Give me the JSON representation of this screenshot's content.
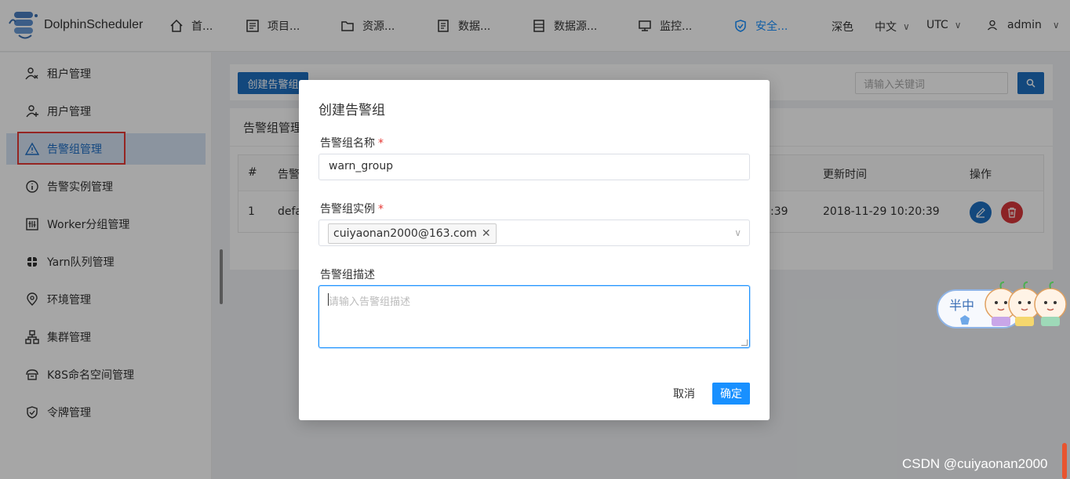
{
  "app": {
    "name": "DolphinScheduler"
  },
  "nav": {
    "items": [
      {
        "label": "首...",
        "icon": "home-icon"
      },
      {
        "label": "项目...",
        "icon": "project-icon"
      },
      {
        "label": "资源...",
        "icon": "folder-icon"
      },
      {
        "label": "数据...",
        "icon": "file-icon"
      },
      {
        "label": "数据源...",
        "icon": "datasource-icon"
      },
      {
        "label": "监控...",
        "icon": "monitor-icon"
      },
      {
        "label": "安全...",
        "icon": "security-icon"
      }
    ],
    "theme_label": "深色",
    "language": "中文",
    "timezone": "UTC",
    "user": "admin"
  },
  "sidebar": {
    "items": [
      {
        "label": "租户管理",
        "icon": "tenant-icon"
      },
      {
        "label": "用户管理",
        "icon": "user-icon"
      },
      {
        "label": "告警组管理",
        "icon": "warning-icon"
      },
      {
        "label": "告警实例管理",
        "icon": "info-icon"
      },
      {
        "label": "Worker分组管理",
        "icon": "worker-icon"
      },
      {
        "label": "Yarn队列管理",
        "icon": "yarn-icon"
      },
      {
        "label": "环境管理",
        "icon": "location-icon"
      },
      {
        "label": "集群管理",
        "icon": "cluster-icon"
      },
      {
        "label": "K8S命名空间管理",
        "icon": "k8s-icon"
      },
      {
        "label": "令牌管理",
        "icon": "token-icon"
      }
    ],
    "active_index": 2
  },
  "main": {
    "create_button": "创建告警组",
    "search_placeholder": "请输入关键词",
    "panel_title": "告警组管理",
    "table": {
      "headers": [
        "#",
        "告警",
        "更新时间",
        "操作"
      ],
      "rows": [
        {
          "index": "1",
          "name": "defa",
          "create_time_fragment": ":39",
          "update_time": "2018-11-29 10:20:39"
        }
      ]
    }
  },
  "modal": {
    "title": "创建告警组",
    "name_label": "告警组名称",
    "name_value": "warn_group",
    "instance_label": "告警组实例",
    "instance_tag": "cuiyaonan2000@163.com",
    "desc_label": "告警组描述",
    "desc_placeholder": "请输入告警组描述",
    "required_mark": "*",
    "cancel": "取消",
    "confirm": "确定"
  },
  "decor": {
    "sticker_text": "半中",
    "watermark": "CSDN @cuiyaonan2000"
  },
  "colors": {
    "primary": "#1890ff",
    "sidebar_active_bg": "#d6e4f5",
    "danger": "#e53935",
    "edit_btn": "#1e6fc1"
  }
}
